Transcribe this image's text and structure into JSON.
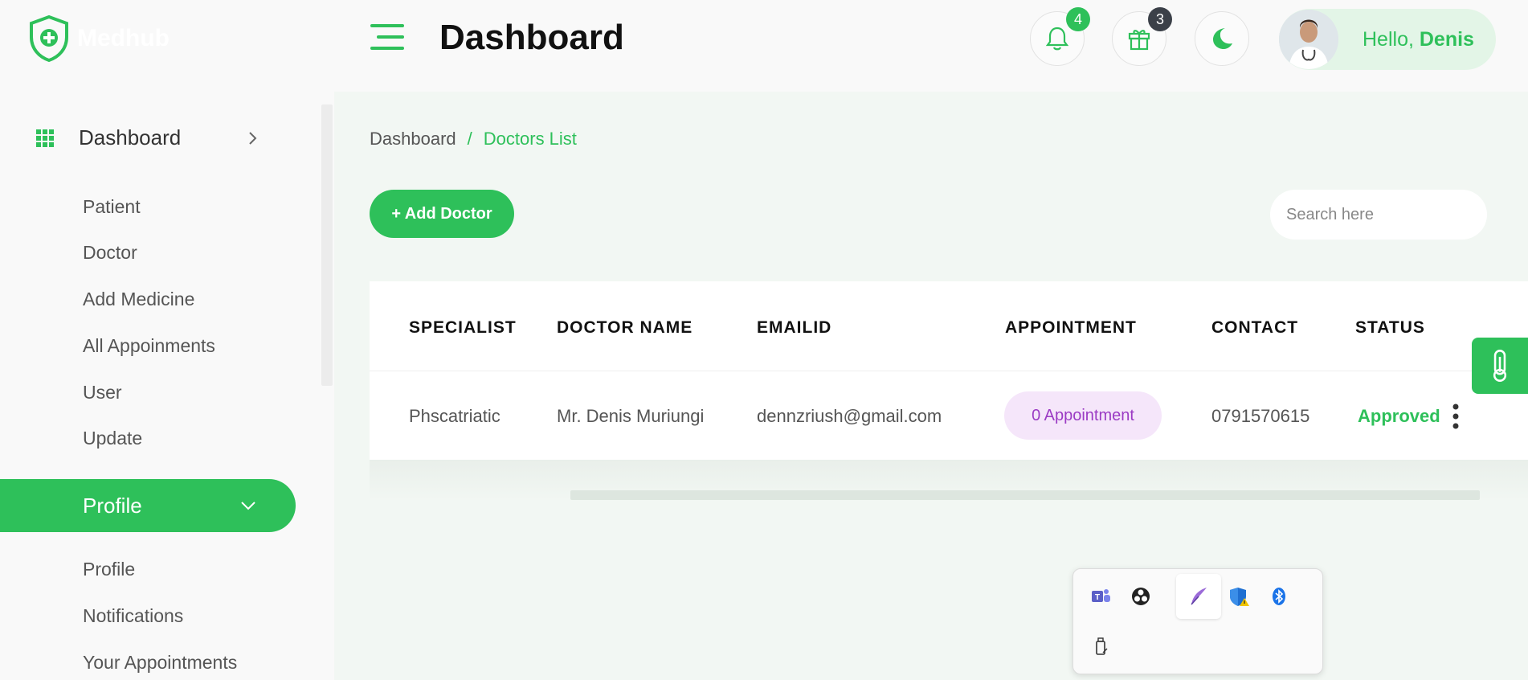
{
  "app": {
    "logo_text": "Medhub",
    "colors": {
      "accent": "#2ec05a",
      "badge_green": "#2ec05a",
      "badge_dark": "#3b4048",
      "pill_bg": "#f5e6fa",
      "pill_text": "#9b3bc4"
    }
  },
  "header": {
    "title": "Dashboard",
    "notifications": {
      "icon": "bell-icon",
      "count": "4"
    },
    "gifts": {
      "icon": "gift-icon",
      "count": "3"
    },
    "theme_toggle": {
      "icon": "moon-icon"
    },
    "user": {
      "greeting": "Hello,",
      "name": "Denis"
    }
  },
  "sidebar": {
    "main_item": {
      "label": "Dashboard",
      "icon": "grid-icon"
    },
    "items": [
      {
        "label": "Patient"
      },
      {
        "label": "Doctor"
      },
      {
        "label": "Add Medicine"
      },
      {
        "label": "All Appoinments"
      },
      {
        "label": "User"
      },
      {
        "label": "Update"
      }
    ],
    "active_section": {
      "label": "Profile"
    },
    "profile_items": [
      {
        "label": "Profile"
      },
      {
        "label": "Notifications"
      },
      {
        "label": "Your Appointments"
      }
    ]
  },
  "main": {
    "breadcrumb": {
      "root": "Dashboard",
      "separator": "/",
      "current": "Doctors List"
    },
    "add_button": "+ Add Doctor",
    "search": {
      "placeholder": "Search here",
      "value": ""
    },
    "table": {
      "columns": [
        "SPECIALIST",
        "DOCTOR NAME",
        "EMAILID",
        "APPOINTMENT",
        "CONTACT",
        "STATUS"
      ],
      "rows": [
        {
          "specialist": "Phscatriatic",
          "doctor_name": "Mr. Denis Muriungi",
          "email": "dennzriush@gmail.com",
          "appointment": "0 Appointment",
          "contact": "0791570615",
          "status": "Approved"
        }
      ]
    }
  },
  "tray": {
    "icons": [
      "teams-icon",
      "obs-icon",
      "feather-pen-icon",
      "defender-warning-icon",
      "bluetooth-icon",
      "usb-drive-icon"
    ]
  }
}
